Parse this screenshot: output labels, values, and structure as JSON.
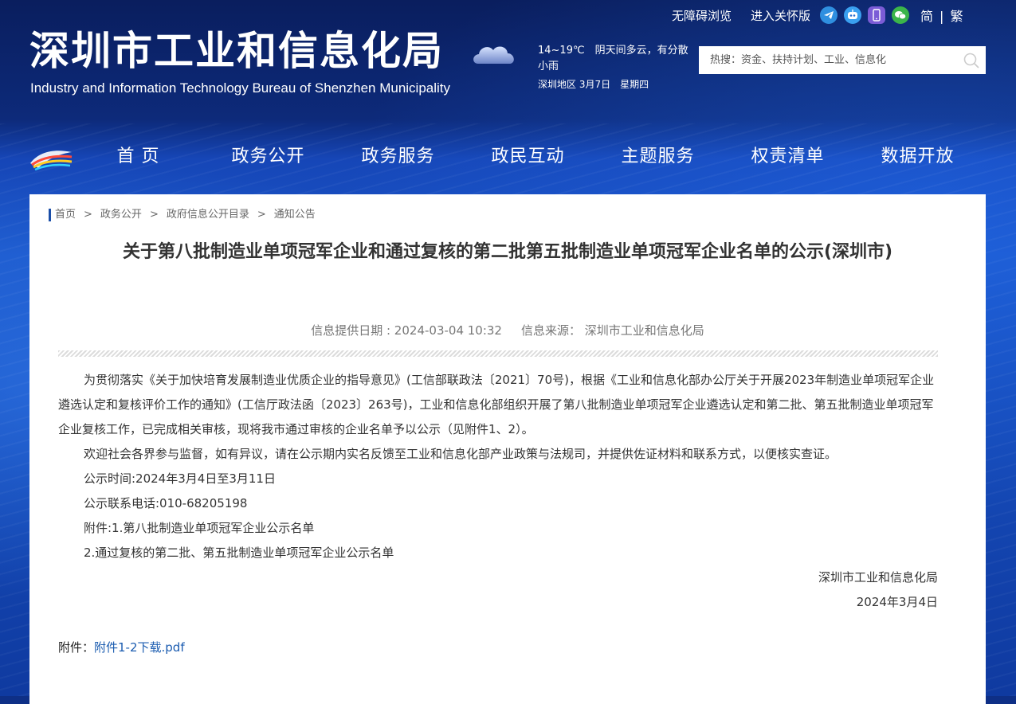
{
  "header": {
    "title_zh": "深圳市工业和信息化局",
    "title_en": "Industry and Information Technology Bureau of Shenzhen Municipality",
    "weather": {
      "temp_desc": "14~19℃　阴天间多云，有分散小雨",
      "date": "深圳地区 3月7日　星期四"
    },
    "links": {
      "accessibility": "无障碍浏览",
      "care_mode": "进入关怀版"
    },
    "icons": [
      "telegram-icon",
      "robot-icon",
      "mobile-icon",
      "wechat-icon"
    ],
    "lang": {
      "simplified": "简",
      "separator": "|",
      "traditional": "繁"
    },
    "search": {
      "placeholder": "热搜：资金、扶持计划、工业、信息化"
    }
  },
  "nav": {
    "items": [
      "首 页",
      "政务公开",
      "政务服务",
      "政民互动",
      "主题服务",
      "权责清单",
      "数据开放"
    ]
  },
  "breadcrumb": [
    "首页",
    "政务公开",
    "政府信息公开目录",
    "通知公告"
  ],
  "breadcrumb_sep": ">",
  "article": {
    "title": "关于第八批制造业单项冠军企业和通过复核的第二批第五批制造业单项冠军企业名单的公示(深圳市)",
    "meta_date": "信息提供日期 : 2024-03-04 10:32",
    "meta_source": "信息来源：  深圳市工业和信息化局",
    "paragraphs": [
      "为贯彻落实《关于加快培育发展制造业优质企业的指导意见》(工信部联政法〔2021〕70号)，根据《工业和信息化部办公厅关于开展2023年制造业单项冠军企业遴选认定和复核评价工作的通知》(工信厅政法函〔2023〕263号)，工业和信息化部组织开展了第八批制造业单项冠军企业遴选认定和第二批、第五批制造业单项冠军企业复核工作，已完成相关审核，现将我市通过审核的企业名单予以公示（见附件1、2）。",
      "欢迎社会各界参与监督，如有异议，请在公示期内实名反馈至工业和信息化部产业政策与法规司，并提供佐证材料和联系方式，以便核实查证。",
      "公示时间:2024年3月4日至3月11日",
      "公示联系电话:010-68205198",
      "附件:1.第八批制造业单项冠军企业公示名单",
      "2.通过复核的第二批、第五批制造业单项冠军企业公示名单"
    ],
    "signature": "深圳市工业和信息化局",
    "sign_date": "2024年3月4日",
    "attachment_label": "附件：",
    "attachment_link": "附件1-2下载.pdf"
  },
  "colors": {
    "header_bg": "#0a1e5e",
    "nav_bg": "#1646b7",
    "accent": "#1b4ea8",
    "link": "#1b5cb0"
  }
}
